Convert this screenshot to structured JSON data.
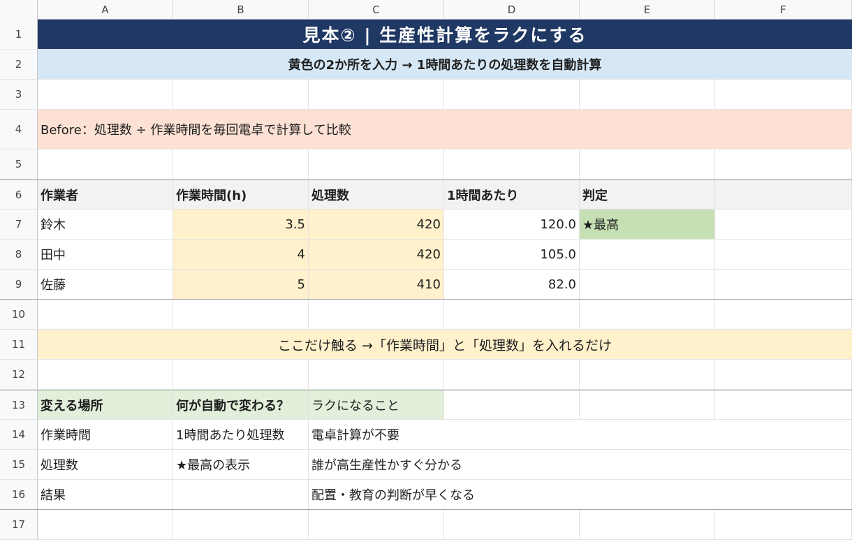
{
  "columns": [
    "A",
    "B",
    "C",
    "D",
    "E",
    "F"
  ],
  "rows": [
    "1",
    "2",
    "3",
    "4",
    "5",
    "6",
    "7",
    "8",
    "9",
    "10",
    "11",
    "12",
    "13",
    "14",
    "15",
    "16",
    "17"
  ],
  "title": "見本② | 生産性計算をラクにする",
  "subtitle": "黄色の2か所を入力 → 1時間あたりの処理数を自動計算",
  "before_text": "Before：処理数 ÷ 作業時間を毎回電卓で計算して比較",
  "table1": {
    "headers": [
      "作業者",
      "作業時間(h)",
      "処理数",
      "1時間あたり",
      "判定"
    ],
    "rows": [
      {
        "name": "鈴木",
        "hours": "3.5",
        "count": "420",
        "per_hour": "120.0",
        "judge": "★最高"
      },
      {
        "name": "田中",
        "hours": "4",
        "count": "420",
        "per_hour": "105.0",
        "judge": ""
      },
      {
        "name": "佐藤",
        "hours": "5",
        "count": "410",
        "per_hour": "82.0",
        "judge": ""
      }
    ]
  },
  "touch_note": "ここだけ触る →「作業時間」と「処理数」を入れるだけ",
  "table2": {
    "headers": [
      "変える場所",
      "何が自動で変わる？",
      "ラクになること"
    ],
    "rows": [
      {
        "place": "作業時間",
        "auto": "1時間あたり処理数",
        "benefit": "電卓計算が不要"
      },
      {
        "place": "処理数",
        "auto": "★最高の表示",
        "benefit": "誰が高生産性かすぐ分かる"
      },
      {
        "place": "結果",
        "auto": "",
        "benefit": "配置・教育の判断が早くなる"
      }
    ]
  },
  "colors": {
    "title_bg": "#1f3864",
    "subtitle_bg": "#d6e8f6",
    "before_bg": "#fce1d4",
    "input_bg": "#fff1cc",
    "best_bg": "#c6e0b4",
    "header2_bg": "#e2efda"
  }
}
